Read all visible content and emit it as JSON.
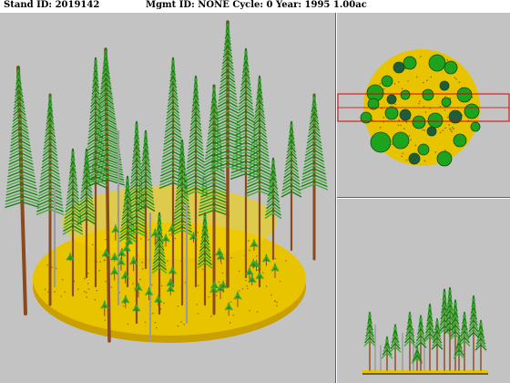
{
  "header": {
    "stand_id": "Stand ID: 2019142",
    "mgmt_info": "Mgmt ID: NONE Cycle: 0 Year: 1995 1.00ac"
  },
  "colors": {
    "panel_bg": "#c3c3c3",
    "ground": "#e8c400",
    "ground_edge": "#c9a000",
    "foliage": "#3fae2f",
    "foliage_dark": "#1e7a1e",
    "trunk": "#8a4a1e",
    "snag": "#9a9a9a",
    "crown_bright": "#1ea31e",
    "crown_dark": "#1f5c3a",
    "selection": "#d40000"
  },
  "panels": {
    "main": "perspective-stand-view",
    "overhead": "overhead-plot-view",
    "profile": "side-profile-view"
  }
}
